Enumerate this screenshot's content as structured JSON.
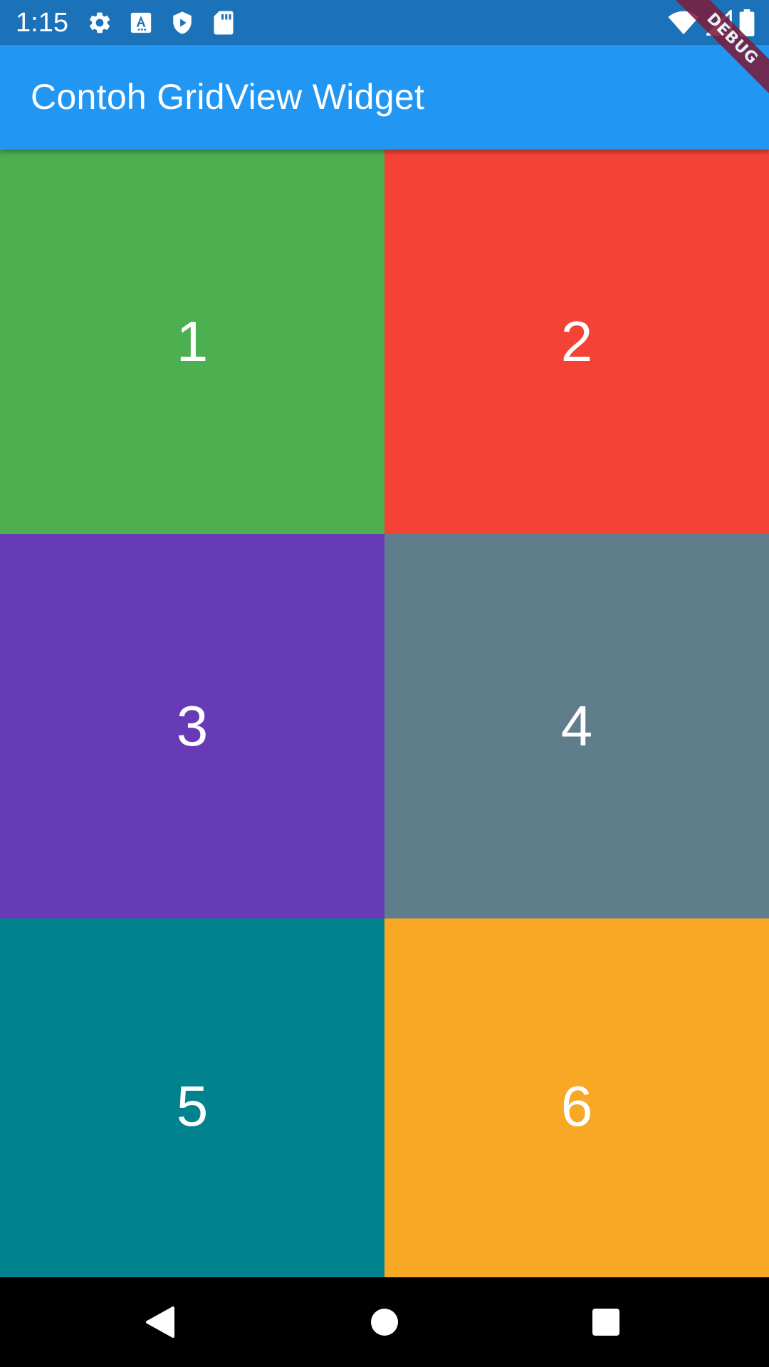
{
  "status_bar": {
    "time": "1:15",
    "background": "#1c72b8",
    "left_icons": [
      "gear-icon",
      "a-text-icon",
      "play-shield-icon",
      "sd-card-icon"
    ],
    "right_icons": [
      "wifi-icon",
      "cell-signal-icon",
      "battery-icon"
    ]
  },
  "app_bar": {
    "title": "Contoh GridView Widget",
    "background": "#2196f3"
  },
  "debug_banner": {
    "label": "DEBUG",
    "color": "#7a1e3e"
  },
  "grid": {
    "tiles": [
      {
        "label": "1",
        "color": "#4caf50"
      },
      {
        "label": "2",
        "color": "#f44336"
      },
      {
        "label": "3",
        "color": "#673ab7"
      },
      {
        "label": "4",
        "color": "#607d8b"
      },
      {
        "label": "5",
        "color": "#00838f"
      },
      {
        "label": "6",
        "color": "#f9a825"
      }
    ]
  },
  "nav_bar": {
    "buttons": [
      "back-icon",
      "home-icon",
      "recents-icon"
    ]
  }
}
